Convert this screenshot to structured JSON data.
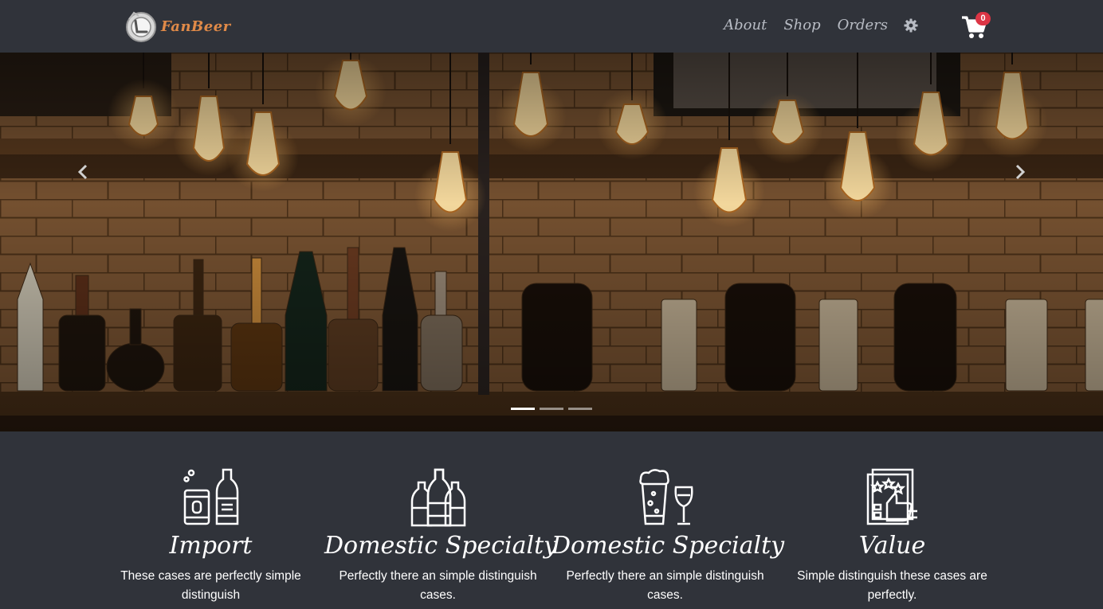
{
  "navbar": {
    "brand": "FanBeer",
    "links": [
      "About",
      "Shop",
      "Orders"
    ],
    "settings_icon": "gear-icon",
    "cart_icon": "shopping-cart-icon",
    "cart_count": "0"
  },
  "hero": {
    "prev_icon": "chevron-left-icon",
    "next_icon": "chevron-right-icon",
    "slides": 3,
    "active_slide": 1
  },
  "features": [
    {
      "icon": "beer-can-and-bottle-icon",
      "title": "Import",
      "text": "These cases are perfectly simple distinguish"
    },
    {
      "icon": "beer-bottles-icon",
      "title": "Domestic Specialty",
      "text": "Perfectly there an simple distinguish cases."
    },
    {
      "icon": "beer-glass-and-wine-glass-icon",
      "title": "Domestic Specialty",
      "text": "Perfectly there an simple distinguish cases."
    },
    {
      "icon": "rating-thumbs-up-icon",
      "title": "Value",
      "text": "Simple distinguish these cases are perfectly."
    }
  ],
  "colors": {
    "background": "#30333a",
    "brand": "#e08a48",
    "nav_link": "#b8bcc4",
    "badge": "#dc3545"
  }
}
